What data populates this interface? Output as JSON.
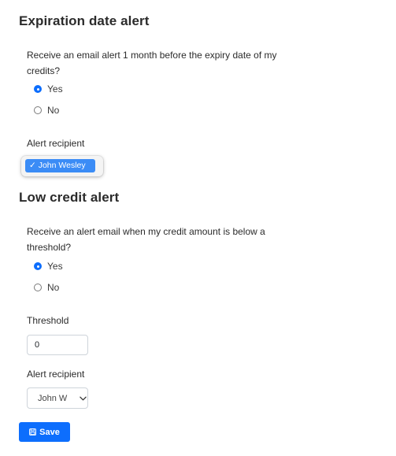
{
  "expiration_alert": {
    "title": "Expiration date alert",
    "question": "Receive an email alert 1 month before the expiry date of my credits?",
    "options": [
      {
        "label": "Yes",
        "selected": true
      },
      {
        "label": "No",
        "selected": false
      }
    ],
    "recipient_label": "Alert recipient",
    "recipient_dropdown_option": "✓ John Wesley"
  },
  "low_credit_alert": {
    "title": "Low credit alert",
    "question": "Receive an alert email when my credit amount is below a threshold?",
    "options": [
      {
        "label": "Yes",
        "selected": true
      },
      {
        "label": "No",
        "selected": false
      }
    ],
    "threshold_label": "Threshold",
    "threshold_value": "0",
    "recipient_label": "Alert recipient",
    "recipient_value": "John W"
  },
  "save_button": {
    "label": "Save",
    "icon": "save-icon"
  },
  "colors": {
    "primary": "#0d6efd",
    "dropdown_highlight": "#3b8cf6"
  }
}
